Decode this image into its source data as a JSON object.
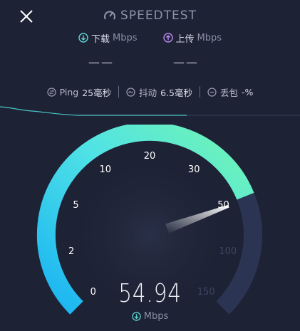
{
  "header": {
    "app_title": "SPEEDTEST"
  },
  "metrics": {
    "download_label": "下载",
    "upload_label": "上传",
    "unit": "Mbps",
    "download_value": "——",
    "upload_value": "——"
  },
  "stats": {
    "ping_label": "Ping",
    "ping_value": "25毫秒",
    "jitter_label": "抖动",
    "jitter_value": "6.5毫秒",
    "loss_label": "丢包",
    "loss_value": "-%"
  },
  "gauge": {
    "ticks": [
      "0",
      "2",
      "5",
      "10",
      "20",
      "30",
      "50",
      "100",
      "150"
    ],
    "active_tick_count": 7,
    "reading": "54.94",
    "reading_unit": "Mbps"
  },
  "colors": {
    "background": "#1e2235",
    "download_accent": "#5ad4d0",
    "upload_accent": "#b98cf0",
    "arc_start": "#1fb8f4",
    "arc_end": "#6ef3b6",
    "arc_inactive": "#2a3452"
  },
  "icons": [
    "close-icon",
    "speedometer-icon",
    "download-icon",
    "upload-icon",
    "ping-icon",
    "jitter-icon",
    "packet-loss-icon"
  ]
}
